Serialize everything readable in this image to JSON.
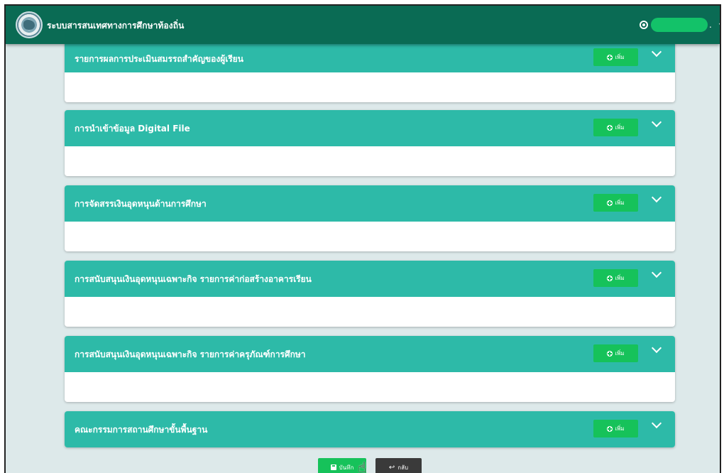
{
  "navbar": {
    "title": "ระบบสารสนเทศทางการศึกษาท้องถิ่น",
    "user_suffix": ".",
    "caret": "▾"
  },
  "cards": [
    {
      "title": "รายการผลการประเมินสมรรถสำคัญของผู้เรียน",
      "add_label": "เพิ่ม"
    },
    {
      "title": "การนำเข้าข้อมูล Digital File",
      "add_label": "เพิ่ม"
    },
    {
      "title": "การจัดสรรเงินอุดหนุนด้านการศึกษา",
      "add_label": "เพิ่ม"
    },
    {
      "title": "การสนับสนุนเงินอุดหนุนเฉพาะกิจ รายการค่าก่อสร้างอาคารเรียน",
      "add_label": "เพิ่ม"
    },
    {
      "title": "การสนับสนุนเงินอุดหนุนเฉพาะกิจ รายการค่าครุภัณฑ์การศึกษา",
      "add_label": "เพิ่ม"
    },
    {
      "title": "คณะกรรมการสถานศึกษาขั้นพื้นฐาน",
      "add_label": "เพิ่ม"
    }
  ],
  "footer": {
    "save_label": "บันทึก",
    "back_label": "กลับ"
  },
  "colors": {
    "navbar": "#0a6b54",
    "card_header": "#2dbaa8",
    "button_green": "#16c25a",
    "page_bg": "#dde9ea"
  },
  "icons": [
    "user-icon",
    "plus-circle-icon",
    "chevron-down-icon",
    "save-icon",
    "reply-icon",
    "hand-cursor-icon"
  ]
}
